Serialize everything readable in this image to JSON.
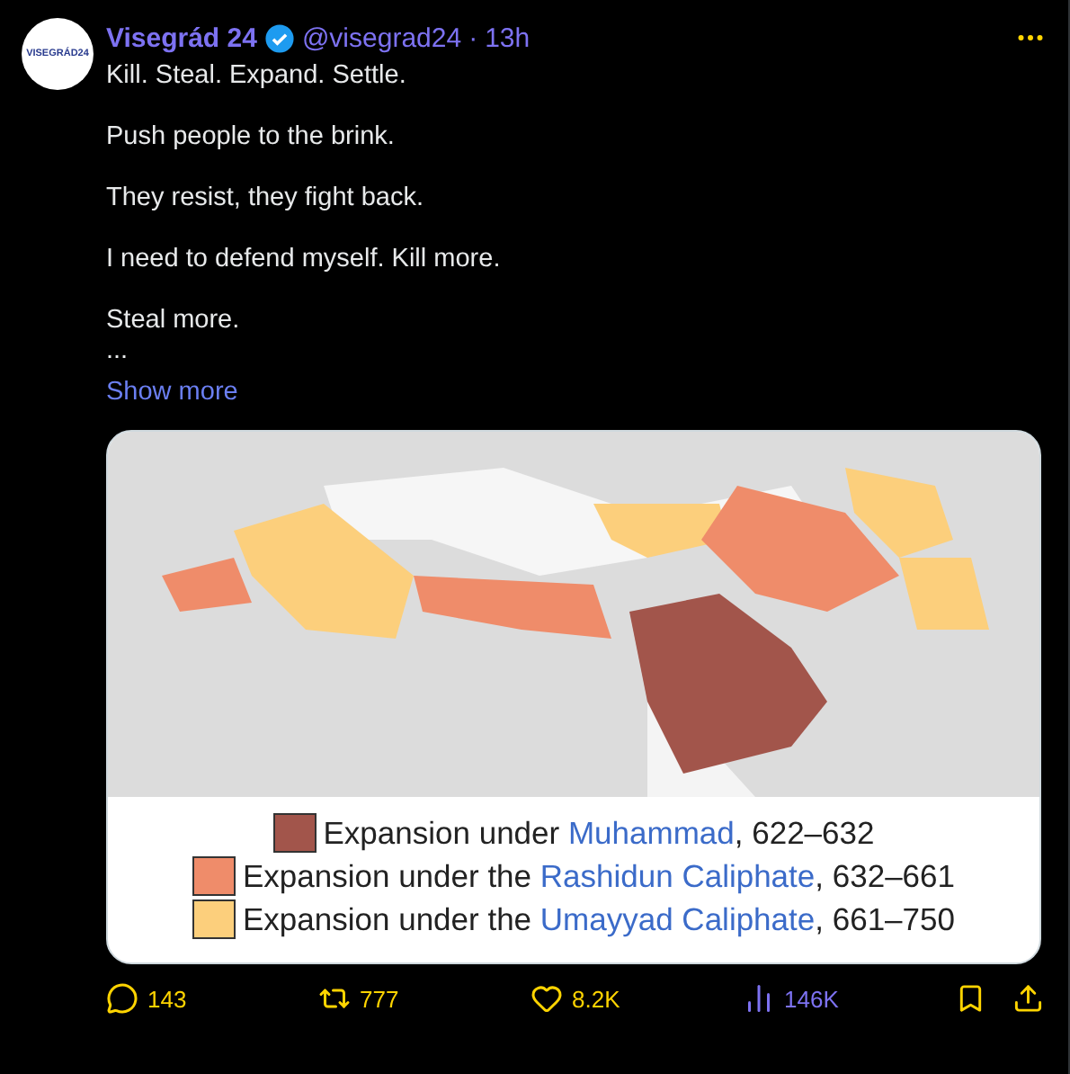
{
  "author": {
    "avatar_text": "VISEGRÁD24",
    "name": "Visegrád 24",
    "verified": true,
    "handle": "@visegrad24",
    "separator": "·",
    "time": "13h"
  },
  "paragraphs": [
    "Kill. Steal. Expand. Settle.",
    "Push people to the brink.",
    "They resist, they fight back.",
    "I need to defend myself. Kill more.",
    "Steal more.\n..."
  ],
  "show_more": "Show more",
  "media": {
    "kind": "picture",
    "legend": [
      {
        "color": "#a2554b",
        "before": "Expansion under ",
        "link": "Muhammad",
        "after": ", 622–632"
      },
      {
        "color": "#ef8c6a",
        "before": "Expansion under the ",
        "link": "Rashidun Caliphate",
        "after": ", 632–661"
      },
      {
        "color": "#fccf7c",
        "before": "Expansion under the ",
        "link": "Umayyad Caliphate",
        "after": ", 661–750"
      }
    ]
  },
  "actions": [
    {
      "kind": "reply",
      "count": "143"
    },
    {
      "kind": "repost",
      "count": "777"
    },
    {
      "kind": "like",
      "count": "8.2K"
    },
    {
      "kind": "views",
      "count": "146K"
    },
    {
      "kind": "bookmark"
    },
    {
      "kind": "share"
    }
  ]
}
